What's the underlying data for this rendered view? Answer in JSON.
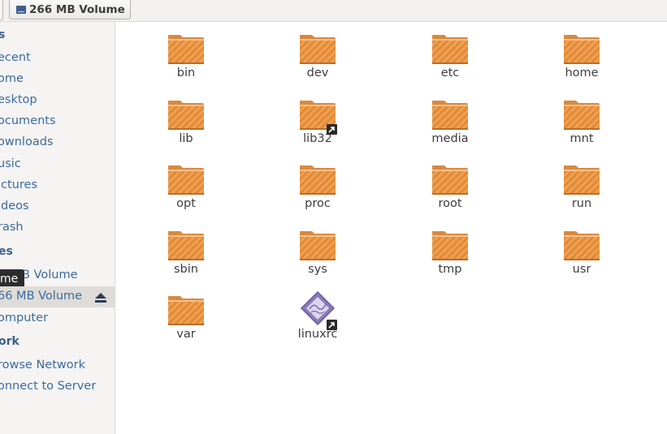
{
  "toolbar": {
    "location_label": "266 MB Volume"
  },
  "sidebar": {
    "section_places_tail": "s",
    "items_places": [
      "ecent",
      "ome",
      "esktop",
      "ocuments",
      "ownloads",
      "usic",
      "ictures",
      "ideos",
      "rash"
    ],
    "section_devices_tail": "es",
    "devices": [
      "B Volume",
      "66 MB Volume",
      "omputer"
    ],
    "tooltip_text": "me",
    "section_network_tail": "ork",
    "network": [
      "rowse Network",
      "onnect to Server"
    ]
  },
  "files": [
    {
      "name": "bin",
      "type": "folder"
    },
    {
      "name": "dev",
      "type": "folder"
    },
    {
      "name": "etc",
      "type": "folder"
    },
    {
      "name": "home",
      "type": "folder"
    },
    {
      "name": "lib",
      "type": "folder"
    },
    {
      "name": "lib32",
      "type": "folder-link"
    },
    {
      "name": "media",
      "type": "folder"
    },
    {
      "name": "mnt",
      "type": "folder"
    },
    {
      "name": "opt",
      "type": "folder"
    },
    {
      "name": "proc",
      "type": "folder"
    },
    {
      "name": "root",
      "type": "folder"
    },
    {
      "name": "run",
      "type": "folder"
    },
    {
      "name": "sbin",
      "type": "folder"
    },
    {
      "name": "sys",
      "type": "folder"
    },
    {
      "name": "tmp",
      "type": "folder"
    },
    {
      "name": "usr",
      "type": "folder"
    },
    {
      "name": "var",
      "type": "folder"
    },
    {
      "name": "linuxrc",
      "type": "executable-link"
    }
  ],
  "colors": {
    "folder_body": "#f0a050",
    "folder_stripe": "#e08a38",
    "sidebar_link": "#3b6aa0",
    "selected_row": "#dedcd8"
  }
}
